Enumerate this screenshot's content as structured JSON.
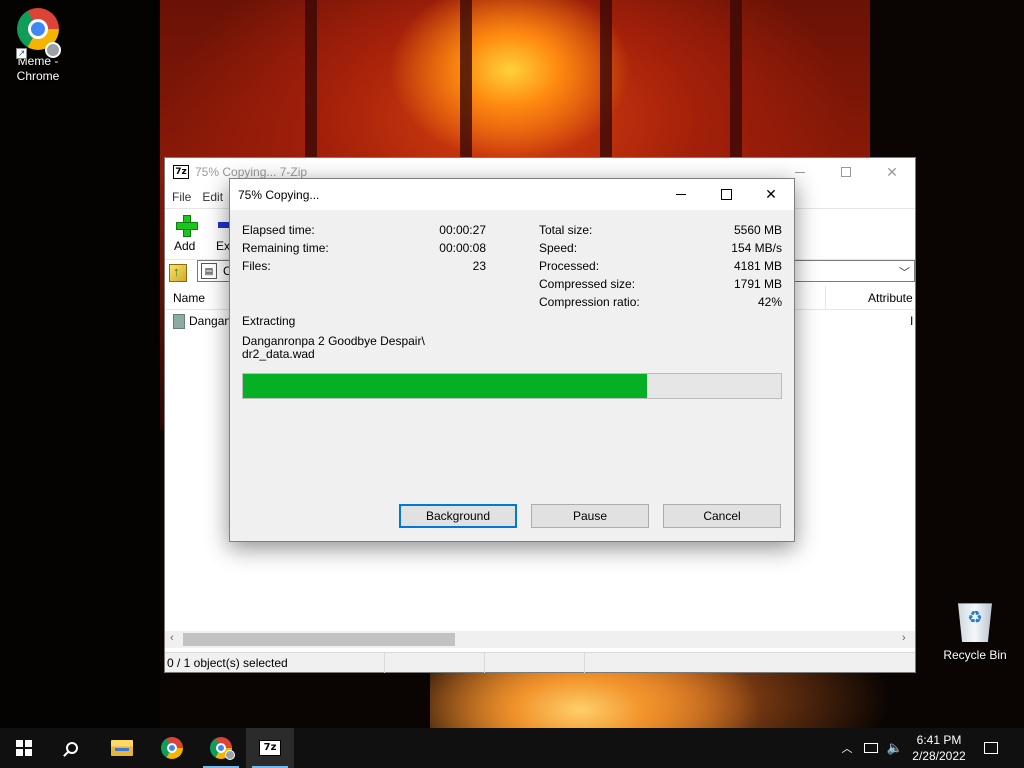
{
  "desktop": {
    "icons": [
      {
        "label": "Meme -\nChrome",
        "icon": "chrome-icon"
      },
      {
        "label": "Recycle Bin",
        "icon": "recycle-bin-icon"
      }
    ]
  },
  "main_window": {
    "title": "75% Copying... 7-Zip",
    "logo_text": "7z",
    "menu": [
      "File",
      "Edit"
    ],
    "toolbar": [
      {
        "label": "Add",
        "icon": "add-icon"
      },
      {
        "label": "Extr",
        "icon": "extract-icon"
      }
    ],
    "address": "C",
    "columns": {
      "name": "Name",
      "attributes": "Attribute"
    },
    "rows": [
      {
        "name": "Dangan",
        "attributes": "I"
      }
    ],
    "status": "0 / 1 object(s) selected"
  },
  "dialog": {
    "title": "75% Copying...",
    "left_stats": [
      {
        "label": "Elapsed time:",
        "value": "00:00:27"
      },
      {
        "label": "Remaining time:",
        "value": "00:00:08"
      },
      {
        "label": "Files:",
        "value": "23"
      }
    ],
    "right_stats": [
      {
        "label": "Total size:",
        "value": "5560 MB"
      },
      {
        "label": "Speed:",
        "value": "154 MB/s"
      },
      {
        "label": "Processed:",
        "value": "4181 MB"
      },
      {
        "label": "Compressed size:",
        "value": "1791 MB"
      },
      {
        "label": "Compression ratio:",
        "value": "42%"
      }
    ],
    "operation": "Extracting",
    "path_line1": "Danganronpa 2 Goodbye Despair\\",
    "path_line2": "dr2_data.wad",
    "progress_percent": 75,
    "buttons": {
      "background": "Background",
      "pause": "Pause",
      "cancel": "Cancel"
    }
  },
  "taskbar": {
    "items": [
      "start-icon",
      "search-icon",
      "file-explorer-icon",
      "chrome-icon",
      "chrome-profile-icon",
      "7zip-icon"
    ],
    "time": "6:41 PM",
    "date": "2/28/2022"
  },
  "colors": {
    "progress_fill": "#06b025",
    "accent": "#0078d7",
    "taskbar": "#101010"
  }
}
